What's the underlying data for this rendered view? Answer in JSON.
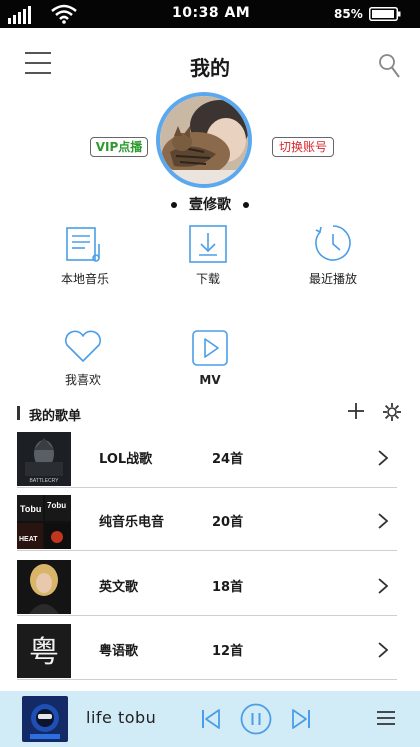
{
  "status_bar": {
    "time": "10:38  AM",
    "battery": "85%"
  },
  "header": {
    "title": "我的",
    "menu_icon": "menu-icon",
    "search_icon": "search-icon"
  },
  "profile": {
    "vip_label": "VIP点播",
    "switch_label": "切换账号",
    "username": "壹修歌"
  },
  "features": [
    {
      "label": "本地音乐",
      "icon": "local-music-icon"
    },
    {
      "label": "下载",
      "icon": "download-icon"
    },
    {
      "label": "最近播放",
      "icon": "recent-play-icon"
    },
    {
      "label": "我喜欢",
      "icon": "heart-icon"
    },
    {
      "label": "MV",
      "icon": "mv-play-icon"
    }
  ],
  "playlists_section": {
    "title": "我的歌单"
  },
  "playlists": [
    {
      "name": "LOL战歌",
      "count": "24首"
    },
    {
      "name": "纯音乐电音",
      "count": "20首"
    },
    {
      "name": "英文歌",
      "count": "18首"
    },
    {
      "name": "粤语歌",
      "count": "12首"
    }
  ],
  "covers": {
    "cover1_text": "BATTLECRY",
    "cover2_text_a": "Tobu",
    "cover2_text_b": "7obu",
    "cover2_text_c": "HEAT",
    "cover4_text": "粤"
  },
  "player": {
    "track": "life  tobu"
  },
  "colors": {
    "accent_blue": "#4a9ee8",
    "player_bg": "#d2ecf7",
    "vip_green": "#2e9a2e",
    "switch_red": "#d8272c"
  }
}
